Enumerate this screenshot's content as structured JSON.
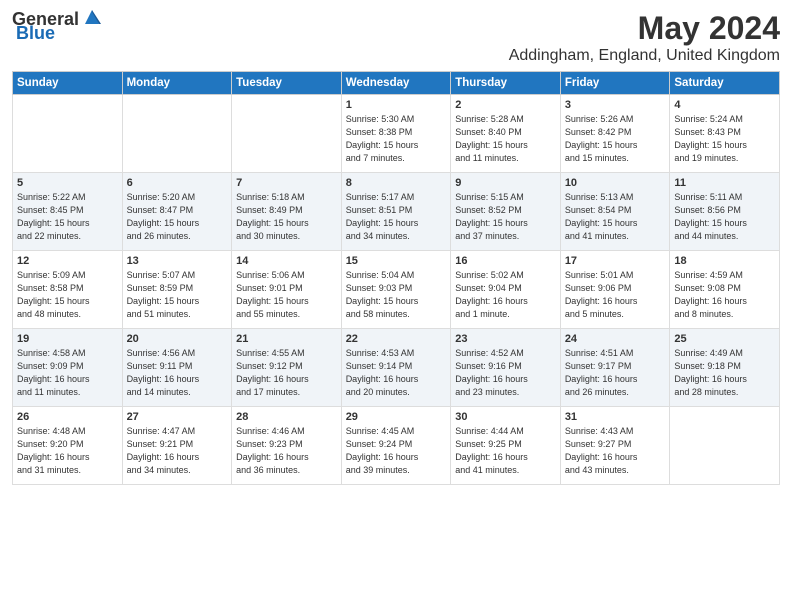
{
  "logo": {
    "general": "General",
    "blue": "Blue"
  },
  "header": {
    "title": "May 2024",
    "subtitle": "Addingham, England, United Kingdom"
  },
  "days_of_week": [
    "Sunday",
    "Monday",
    "Tuesday",
    "Wednesday",
    "Thursday",
    "Friday",
    "Saturday"
  ],
  "weeks": [
    [
      {
        "day": "",
        "info": ""
      },
      {
        "day": "",
        "info": ""
      },
      {
        "day": "",
        "info": ""
      },
      {
        "day": "1",
        "info": "Sunrise: 5:30 AM\nSunset: 8:38 PM\nDaylight: 15 hours\nand 7 minutes."
      },
      {
        "day": "2",
        "info": "Sunrise: 5:28 AM\nSunset: 8:40 PM\nDaylight: 15 hours\nand 11 minutes."
      },
      {
        "day": "3",
        "info": "Sunrise: 5:26 AM\nSunset: 8:42 PM\nDaylight: 15 hours\nand 15 minutes."
      },
      {
        "day": "4",
        "info": "Sunrise: 5:24 AM\nSunset: 8:43 PM\nDaylight: 15 hours\nand 19 minutes."
      }
    ],
    [
      {
        "day": "5",
        "info": "Sunrise: 5:22 AM\nSunset: 8:45 PM\nDaylight: 15 hours\nand 22 minutes."
      },
      {
        "day": "6",
        "info": "Sunrise: 5:20 AM\nSunset: 8:47 PM\nDaylight: 15 hours\nand 26 minutes."
      },
      {
        "day": "7",
        "info": "Sunrise: 5:18 AM\nSunset: 8:49 PM\nDaylight: 15 hours\nand 30 minutes."
      },
      {
        "day": "8",
        "info": "Sunrise: 5:17 AM\nSunset: 8:51 PM\nDaylight: 15 hours\nand 34 minutes."
      },
      {
        "day": "9",
        "info": "Sunrise: 5:15 AM\nSunset: 8:52 PM\nDaylight: 15 hours\nand 37 minutes."
      },
      {
        "day": "10",
        "info": "Sunrise: 5:13 AM\nSunset: 8:54 PM\nDaylight: 15 hours\nand 41 minutes."
      },
      {
        "day": "11",
        "info": "Sunrise: 5:11 AM\nSunset: 8:56 PM\nDaylight: 15 hours\nand 44 minutes."
      }
    ],
    [
      {
        "day": "12",
        "info": "Sunrise: 5:09 AM\nSunset: 8:58 PM\nDaylight: 15 hours\nand 48 minutes."
      },
      {
        "day": "13",
        "info": "Sunrise: 5:07 AM\nSunset: 8:59 PM\nDaylight: 15 hours\nand 51 minutes."
      },
      {
        "day": "14",
        "info": "Sunrise: 5:06 AM\nSunset: 9:01 PM\nDaylight: 15 hours\nand 55 minutes."
      },
      {
        "day": "15",
        "info": "Sunrise: 5:04 AM\nSunset: 9:03 PM\nDaylight: 15 hours\nand 58 minutes."
      },
      {
        "day": "16",
        "info": "Sunrise: 5:02 AM\nSunset: 9:04 PM\nDaylight: 16 hours\nand 1 minute."
      },
      {
        "day": "17",
        "info": "Sunrise: 5:01 AM\nSunset: 9:06 PM\nDaylight: 16 hours\nand 5 minutes."
      },
      {
        "day": "18",
        "info": "Sunrise: 4:59 AM\nSunset: 9:08 PM\nDaylight: 16 hours\nand 8 minutes."
      }
    ],
    [
      {
        "day": "19",
        "info": "Sunrise: 4:58 AM\nSunset: 9:09 PM\nDaylight: 16 hours\nand 11 minutes."
      },
      {
        "day": "20",
        "info": "Sunrise: 4:56 AM\nSunset: 9:11 PM\nDaylight: 16 hours\nand 14 minutes."
      },
      {
        "day": "21",
        "info": "Sunrise: 4:55 AM\nSunset: 9:12 PM\nDaylight: 16 hours\nand 17 minutes."
      },
      {
        "day": "22",
        "info": "Sunrise: 4:53 AM\nSunset: 9:14 PM\nDaylight: 16 hours\nand 20 minutes."
      },
      {
        "day": "23",
        "info": "Sunrise: 4:52 AM\nSunset: 9:16 PM\nDaylight: 16 hours\nand 23 minutes."
      },
      {
        "day": "24",
        "info": "Sunrise: 4:51 AM\nSunset: 9:17 PM\nDaylight: 16 hours\nand 26 minutes."
      },
      {
        "day": "25",
        "info": "Sunrise: 4:49 AM\nSunset: 9:18 PM\nDaylight: 16 hours\nand 28 minutes."
      }
    ],
    [
      {
        "day": "26",
        "info": "Sunrise: 4:48 AM\nSunset: 9:20 PM\nDaylight: 16 hours\nand 31 minutes."
      },
      {
        "day": "27",
        "info": "Sunrise: 4:47 AM\nSunset: 9:21 PM\nDaylight: 16 hours\nand 34 minutes."
      },
      {
        "day": "28",
        "info": "Sunrise: 4:46 AM\nSunset: 9:23 PM\nDaylight: 16 hours\nand 36 minutes."
      },
      {
        "day": "29",
        "info": "Sunrise: 4:45 AM\nSunset: 9:24 PM\nDaylight: 16 hours\nand 39 minutes."
      },
      {
        "day": "30",
        "info": "Sunrise: 4:44 AM\nSunset: 9:25 PM\nDaylight: 16 hours\nand 41 minutes."
      },
      {
        "day": "31",
        "info": "Sunrise: 4:43 AM\nSunset: 9:27 PM\nDaylight: 16 hours\nand 43 minutes."
      },
      {
        "day": "",
        "info": ""
      }
    ]
  ]
}
